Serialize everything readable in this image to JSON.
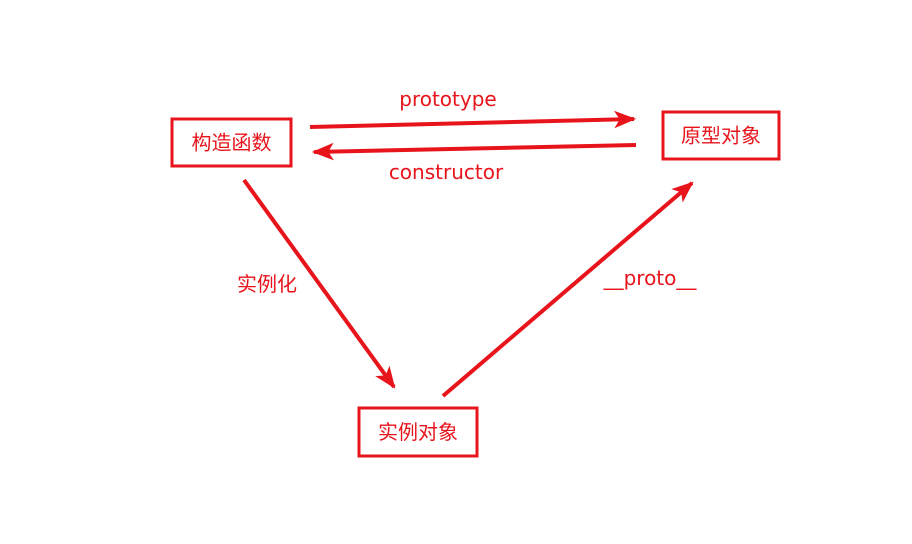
{
  "colors": {
    "accent": "#e8141b",
    "background": "#ffffff"
  },
  "nodes": {
    "constructor_fn": "构造函数",
    "prototype_obj": "原型对象",
    "instance_obj": "实例对象"
  },
  "edges": {
    "prototype": "prototype",
    "constructor": "constructor",
    "instantiate": "实例化",
    "proto": "__proto__"
  }
}
